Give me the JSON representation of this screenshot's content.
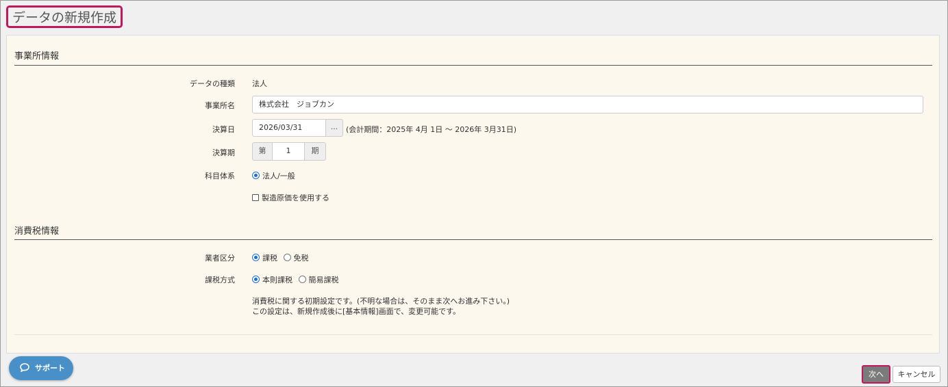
{
  "page": {
    "title": "データの新規作成"
  },
  "office": {
    "section_title": "事業所情報",
    "data_type_label": "データの種類",
    "data_type_value": "法人",
    "name_label": "事業所名",
    "name_value": "株式会社　ジョブカン",
    "closing_date_label": "決算日",
    "closing_date_value": "2026/03/31",
    "closing_date_button": "...",
    "fiscal_period_text": "(会計期間：2025年 4月 1日 〜 2026年 3月31日)",
    "term_label": "決算期",
    "term_prefix": "第",
    "term_value": "1",
    "term_suffix": "期",
    "account_system_label": "科目体系",
    "account_system_option": "法人/一般",
    "manufacturing_cost_label": "製造原価を使用する"
  },
  "tax": {
    "section_title": "消費税情報",
    "business_class_label": "業者区分",
    "business_class_options": [
      "課税",
      "免税"
    ],
    "method_label": "課税方式",
    "method_options": [
      "本則課税",
      "簡易課税"
    ],
    "note_line1": "消費税に関する初期設定です。(不明な場合は、そのまま次へお進み下さい。)",
    "note_line2": "この設定は、新規作成後に[基本情報]画面で、変更可能です。"
  },
  "footer": {
    "support_label": "サポート",
    "next_label": "次へ",
    "cancel_label": "キャンセル"
  },
  "colors": {
    "accent": "#c2185b",
    "primary": "#1a6fd8",
    "support": "#4a90c8",
    "panel": "#fdf8ee"
  }
}
